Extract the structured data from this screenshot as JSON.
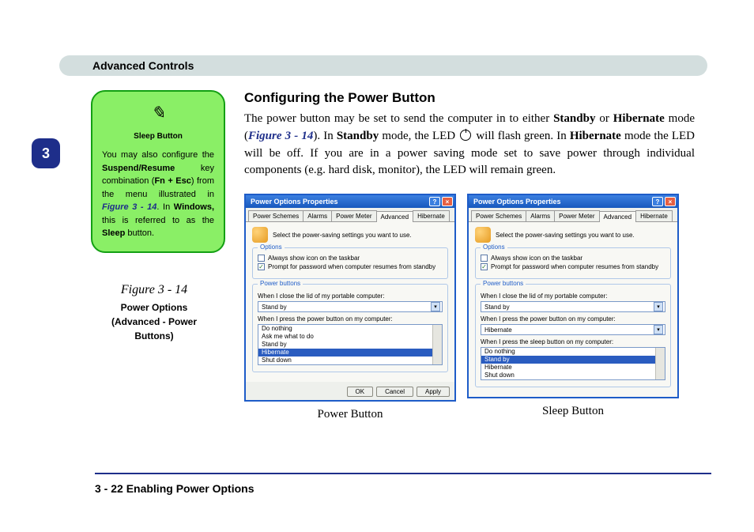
{
  "header": {
    "title": "Advanced Controls"
  },
  "chapter": {
    "number": "3"
  },
  "note": {
    "title": "Sleep Button",
    "body_pre": "You may also configure the ",
    "em1": "Suspend/Resume",
    "body_mid1": " key combination (",
    "em2": "Fn + Esc",
    "body_mid2": ") from the menu illustrated in ",
    "figref": "Figure 3 - 14",
    "body_mid3": ". In ",
    "em3": "Windows,",
    "body_mid4": " this is referred to as the ",
    "em4": "Sleep",
    "body_end": " button."
  },
  "figure_caption": {
    "title": "Figure 3 - 14",
    "sub1": "Power Options",
    "sub2": "(Advanced - Power",
    "sub3": "Buttons)"
  },
  "section": {
    "title": "Configuring the Power Button",
    "p_a": "The power button may be set to send the computer in to either ",
    "p_b": "Standby",
    "p_c": " or ",
    "p_d": "Hibernate",
    "p_e": " mode (",
    "p_fref": "Figure 3 - 14",
    "p_f": "). In ",
    "p_g": "Standby",
    "p_h": " mode, the LED ",
    "p_i": " will flash green. In ",
    "p_j": "Hibernate",
    "p_k": " mode the LED will be off. If you are in a power saving mode set to save power through individual components (e.g. hard disk, monitor), the LED will remain green."
  },
  "dialog_common": {
    "title": "Power Options Properties",
    "tabs": [
      "Power Schemes",
      "Alarms",
      "Power Meter",
      "Advanced",
      "Hibernate"
    ],
    "intro": "Select the power-saving settings you want to use.",
    "options_title": "Options",
    "chk_taskbar": "Always show icon on the taskbar",
    "chk_prompt": "Prompt for password when computer resumes from standby",
    "pb_title": "Power buttons",
    "lbl_lid": "When I close the lid of my portable computer:",
    "val_lid": "Stand by",
    "lbl_power": "When I press the power button on my computer:",
    "val_power": "Hibernate",
    "lbl_sleep": "When I press the sleep button on my computer:",
    "val_sleep": "Stand by",
    "btn_ok": "OK",
    "btn_cancel": "Cancel",
    "btn_apply": "Apply"
  },
  "dropdown_power": [
    "Do nothing",
    "Ask me what to do",
    "Stand by",
    "Hibernate",
    "Shut down"
  ],
  "dropdown_sleep": [
    "Do nothing",
    "Stand by",
    "Hibernate",
    "Shut down"
  ],
  "dropdown_selected": {
    "power": "Hibernate",
    "sleep": "Stand by"
  },
  "captions": {
    "left": "Power Button",
    "right": "Sleep Button"
  },
  "footer": {
    "text": "3  -  22  Enabling Power Options"
  }
}
